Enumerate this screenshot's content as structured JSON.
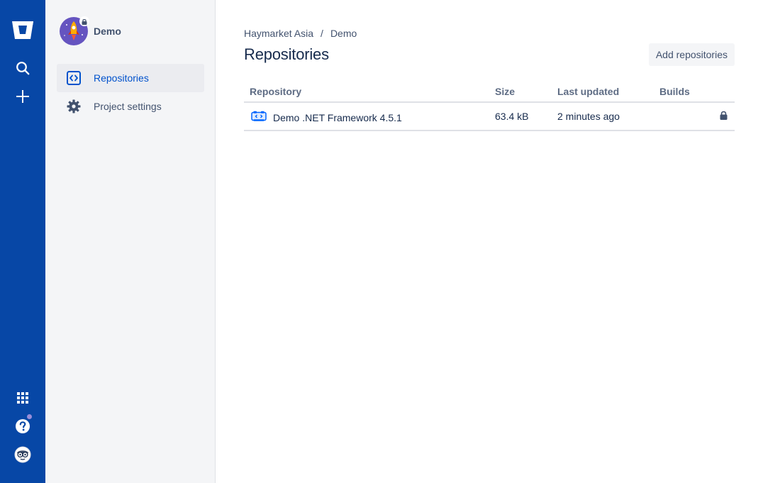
{
  "global_nav": {
    "logo_icon": "bitbucket-logo-icon",
    "search_icon": "search-icon",
    "create_icon": "plus-icon",
    "apps_icon": "app-switcher-icon",
    "help_icon": "help-icon",
    "profile_icon": "avatar-icon",
    "brand_color": "#0747A6"
  },
  "sidebar": {
    "project_name": "Demo",
    "project_avatar_icon": "rocket-icon",
    "items": [
      {
        "label": "Repositories",
        "icon": "code-brackets-icon",
        "active": true
      },
      {
        "label": "Project settings",
        "icon": "gear-icon",
        "active": false
      }
    ]
  },
  "main": {
    "breadcrumb": [
      "Haymarket Asia",
      "Demo"
    ],
    "breadcrumb_separator": "/",
    "title": "Repositories",
    "add_button_label": "Add repositories",
    "table": {
      "columns": [
        "Repository",
        "Size",
        "Last updated",
        "Builds"
      ],
      "rows": [
        {
          "name": "Demo .NET Framework 4.5.1",
          "icon": "repository-icon",
          "size": "63.4 kB",
          "last_updated": "2 minutes ago",
          "builds": "",
          "access_icon": "lock-icon"
        }
      ]
    }
  },
  "colors": {
    "link_active": "#0052CC",
    "text_primary": "#172B4D",
    "text_secondary": "#42526E"
  }
}
